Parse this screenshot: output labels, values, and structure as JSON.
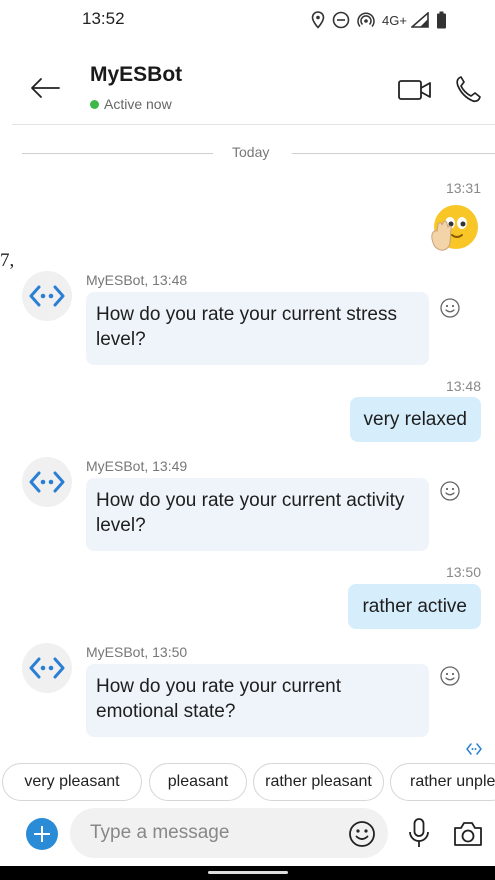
{
  "status_bar": {
    "time": "13:52",
    "network": "4G+",
    "icons": [
      "location-icon",
      "do-not-disturb-icon",
      "hotspot-icon",
      "signal-icon",
      "battery-icon"
    ]
  },
  "header": {
    "title": "MyESBot",
    "presence": "Active now",
    "presence_color": "#3fb84a",
    "back_icon": "arrow-left-icon",
    "video_icon": "video-call-icon",
    "call_icon": "phone-icon"
  },
  "conversation": {
    "day_separator": "Today",
    "edge_glyph": "7,",
    "sent_emoji": {
      "time": "13:31",
      "icon": "waving-face-emoji"
    },
    "messages": [
      {
        "meta": "MyESBot, 13:48",
        "text": "How do you rate your current stress level?"
      },
      {
        "time": "13:48",
        "text": "very relaxed"
      },
      {
        "meta": "MyESBot, 13:49",
        "text": "How do you rate your current activity level?"
      },
      {
        "time": "13:50",
        "text": "rather active"
      },
      {
        "meta": "MyESBot, 13:50",
        "text": "How do you rate your current emotional state?"
      }
    ]
  },
  "quick_replies": [
    "very pleasant",
    "pleasant",
    "rather pleasant",
    "rather unple"
  ],
  "composer": {
    "placeholder": "Type a message",
    "accent": "#2a8bd6"
  },
  "colors": {
    "bot_bubble": "#eef4fa",
    "user_bubble": "#d6eefc",
    "bot_icon": "#2a7fd4"
  }
}
